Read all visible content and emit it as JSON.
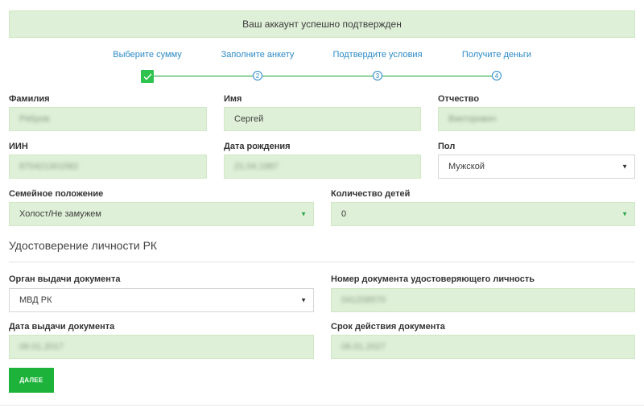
{
  "alert": {
    "text": "Ваш аккаунт успешно подтвержден"
  },
  "steps": [
    {
      "label": "Выберите сумму",
      "number": "1",
      "done": true
    },
    {
      "label": "Заполните анкету",
      "number": "2"
    },
    {
      "label": "Подтвердите условия",
      "number": "3"
    },
    {
      "label": "Получите деньги",
      "number": "4"
    }
  ],
  "personal": {
    "lastname": {
      "label": "Фамилия",
      "value": "Рябров"
    },
    "firstname": {
      "label": "Имя",
      "value": "Сергей"
    },
    "patronymic": {
      "label": "Отчество",
      "value": "Викторович"
    },
    "iin": {
      "label": "ИИН",
      "value": "870421301582"
    },
    "birthdate": {
      "label": "Дата рождения",
      "value": "21.04.1987"
    },
    "gender": {
      "label": "Пол",
      "value": "Мужской"
    },
    "marital": {
      "label": "Семейное положение",
      "value": "Холост/Не замужем"
    },
    "children": {
      "label": "Количество детей",
      "value": "0"
    }
  },
  "identity": {
    "title": "Удостоверение личности РК",
    "issuer": {
      "label": "Орган выдачи документа",
      "value": "МВД РК"
    },
    "doc_number": {
      "label": "Номер документа удостоверяющего личность",
      "value": "041208570"
    },
    "issue_date": {
      "label": "Дата выдачи документа",
      "value": "06.01.2017"
    },
    "expiry_date": {
      "label": "Срок действия документа",
      "value": "06.01.2027"
    }
  },
  "actions": {
    "next_label": "ДАЛЕЕ"
  },
  "colors": {
    "accent_green": "#1db33a",
    "field_bg": "#dff0d8",
    "step_blue": "#2b8ac6"
  }
}
